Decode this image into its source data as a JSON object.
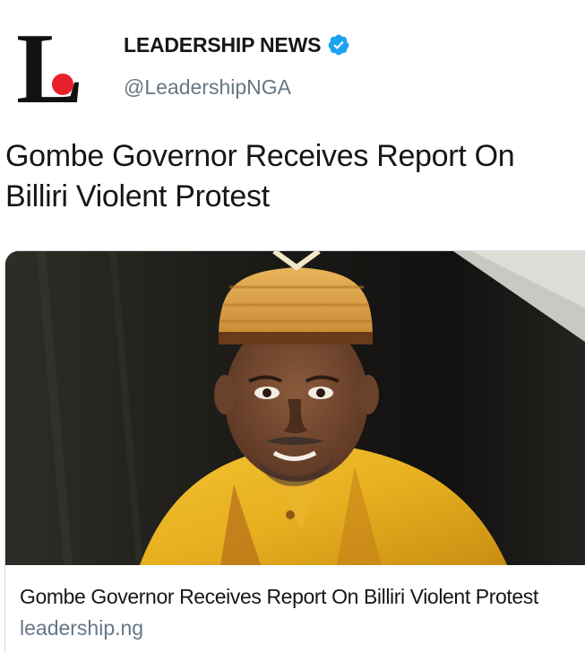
{
  "account": {
    "display_name": "LEADERSHIP NEWS",
    "handle": "@LeadershipNGA",
    "verified": true,
    "avatar_letter": "L",
    "avatar_dot_color": "#e8202a"
  },
  "tweet": {
    "text": "Gombe Governor Receives Report On Billiri Violent Protest"
  },
  "link_card": {
    "title": "Gombe Governor Receives Report On Billiri Violent Protest",
    "domain": "leadership.ng",
    "image_icon": "photo-of-governor-in-gold-attire"
  },
  "colors": {
    "verified_blue": "#1da1f2",
    "secondary_text": "#657786",
    "primary_text": "#14171a",
    "border": "#d6dce0"
  }
}
